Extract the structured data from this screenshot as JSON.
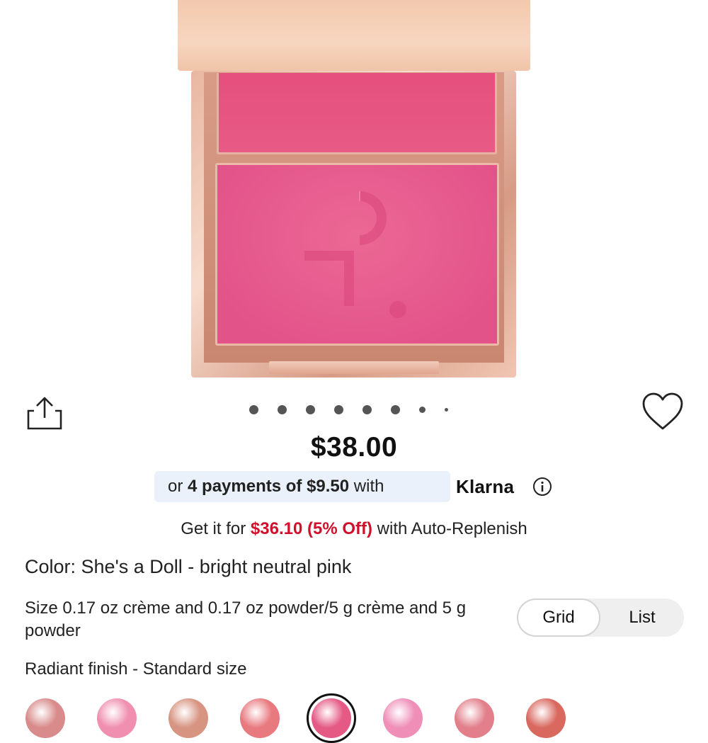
{
  "product": {
    "price": "$38.00",
    "klarna": {
      "prefix": "or",
      "payments": "4 payments of $9.50",
      "suffix": "with",
      "brand": "Klarna"
    },
    "replenish": {
      "prefix": "Get it for",
      "sale_price": "$36.10 (5% Off)",
      "suffix": "with Auto-Replenish"
    },
    "color": "Color: She's a Doll - bright neutral pink",
    "size": "Size 0.17 oz crème and 0.17 oz powder/5 g crème and 5 g powder",
    "finish": "Radiant finish - Standard size"
  },
  "carousel": {
    "dot_count": 8,
    "active_index": 0
  },
  "view_toggle": {
    "grid_label": "Grid",
    "list_label": "List",
    "selected": "Grid"
  },
  "icons": {
    "share": "share-icon",
    "wishlist": "heart-icon",
    "info": "info-icon"
  },
  "colors": {
    "sale_red": "#cf112c",
    "klarna_pill_bg": "#eaf1fb",
    "blush_pink": "#e5507e",
    "compact_rose_gold": "#e8b7a1"
  },
  "swatches": [
    {
      "color": "#d98a8a"
    },
    {
      "color": "#f08fb0"
    },
    {
      "color": "#d79481"
    },
    {
      "color": "#e8797f"
    },
    {
      "color": "#e45a85",
      "selected": true
    },
    {
      "color": "#ef8fb8"
    },
    {
      "color": "#e27f8b"
    },
    {
      "color": "#d9685f"
    }
  ]
}
